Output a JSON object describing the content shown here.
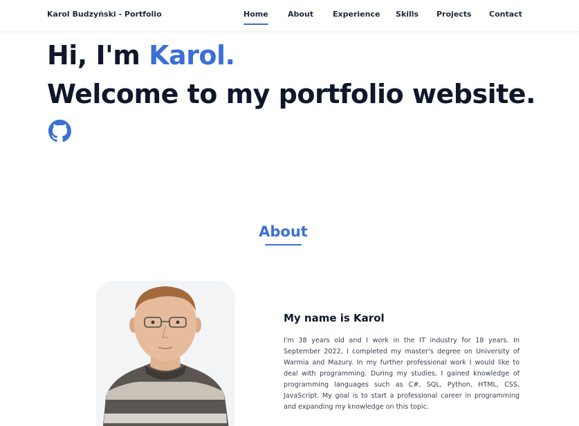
{
  "header": {
    "brand": "Karol Budzyński - Portfolio",
    "nav": [
      {
        "label": "Home",
        "active": true
      },
      {
        "label": "About",
        "active": false
      },
      {
        "label": "Experience",
        "active": false
      },
      {
        "label": "Skills",
        "active": false
      },
      {
        "label": "Projects",
        "active": false
      },
      {
        "label": "Contact",
        "active": false
      }
    ]
  },
  "hero": {
    "greeting": "Hi, I'm ",
    "name": "Karol.",
    "welcome": "Welcome to my portfolio website.",
    "social_icon": "github-icon"
  },
  "about": {
    "title": "About",
    "photo": "profile-photo",
    "heading": "My name is Karol",
    "bio": "I'm 38 years old and I work in the IT industry for 18 years. In September 2022, I completed my master's degree on University of Warmia and Mazury. In my further professional work I would like to deal with programming. During my studies, I gained knowledge of programming languages such as C#, SQL, Python, HTML, CSS, JavaScript. My goal is to start a professional career in programming and expanding my knowledge on this topic."
  },
  "colors": {
    "accent": "#3b6fd8",
    "text": "#0f172a",
    "body_text": "#374151",
    "photo_bg": "#f3f4f6"
  }
}
